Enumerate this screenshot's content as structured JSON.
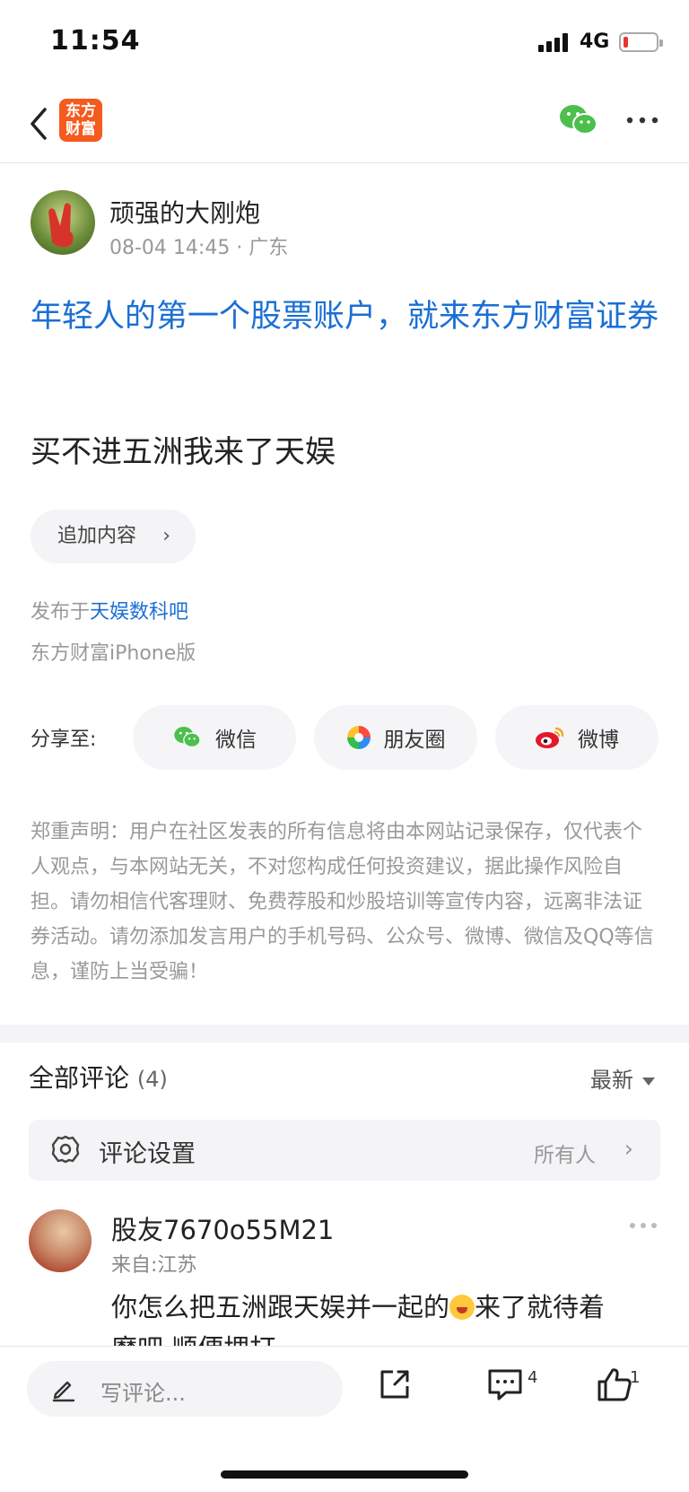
{
  "status_bar": {
    "time": "11:54",
    "network": "4G"
  },
  "nav": {
    "logo_text_line1": "东方",
    "logo_text_line2": "财富"
  },
  "author": {
    "name": "顽强的大刚炮",
    "meta": "08-04 14:45 · 广东"
  },
  "ad_text": "年轻人的第一个股票账户，就来东方财富证券",
  "post_text": "买不进五洲我来了天娱",
  "add_content": "追加内容",
  "published_in_prefix": "发布于",
  "published_in_link": "天娱数科吧",
  "client": "东方财富iPhone版",
  "share": {
    "label": "分享至:",
    "wechat": "微信",
    "moments": "朋友圈",
    "weibo": "微博"
  },
  "disclaimer": "郑重声明：用户在社区发表的所有信息将由本网站记录保存，仅代表个人观点，与本网站无关，不对您构成任何投资建议，据此操作风险自担。请勿相信代客理财、免费荐股和炒股培训等宣传内容，远离非法证券活动。请勿添加发言用户的手机号码、公众号、微博、微信及QQ等信息，谨防上当受骗！",
  "comments": {
    "title": "全部评论",
    "count": "(4)",
    "sort": "最新",
    "settings_label": "评论设置",
    "settings_value": "所有人",
    "items": [
      {
        "name": "股友7670o55M21",
        "from": "来自:江苏",
        "text_before": "你怎么把五洲跟天娱并一起的",
        "text_after": "来了就待着",
        "text_line2": "磨吧 顺便埋打"
      }
    ]
  },
  "bottom": {
    "placeholder": "写评论...",
    "comment_count": "4",
    "like_count": "1"
  },
  "colors": {
    "accent_blue": "#1a6fd4",
    "brand_orange": "#f55a1e",
    "wechat_green": "#4cbf4c"
  }
}
